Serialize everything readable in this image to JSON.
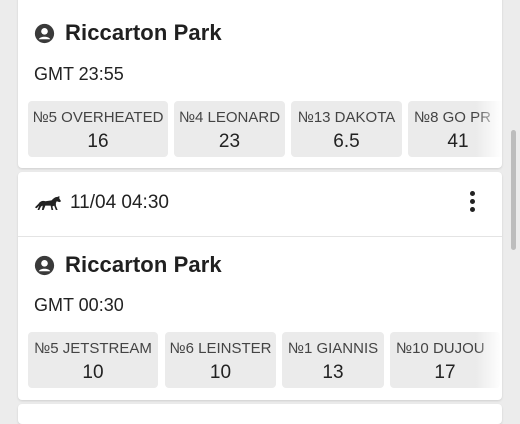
{
  "race_top": {
    "venue": "Riccarton Park",
    "gmt": "GMT 23:55",
    "runners": [
      {
        "name": "№5 OVERHEATED",
        "odds": "16"
      },
      {
        "name": "№4 LEONARD",
        "odds": "23"
      },
      {
        "name": "№13 DAKOTA",
        "odds": "6.5"
      },
      {
        "name": "№8 GO PR",
        "odds": "41"
      }
    ]
  },
  "race_bottom": {
    "date_time": "11/04 04:30",
    "venue": "Riccarton Park",
    "gmt": "GMT 00:30",
    "runners": [
      {
        "name": "№5 JETSTREAM",
        "odds": "10"
      },
      {
        "name": "№6 LEINSTER",
        "odds": "10"
      },
      {
        "name": "№1 GIANNIS",
        "odds": "13"
      },
      {
        "name": "№10 DUJOU",
        "odds": "17"
      }
    ]
  },
  "icons": {
    "horse": "horse-icon",
    "venue": "venue-person-icon",
    "more": "more-vertical-icon"
  }
}
